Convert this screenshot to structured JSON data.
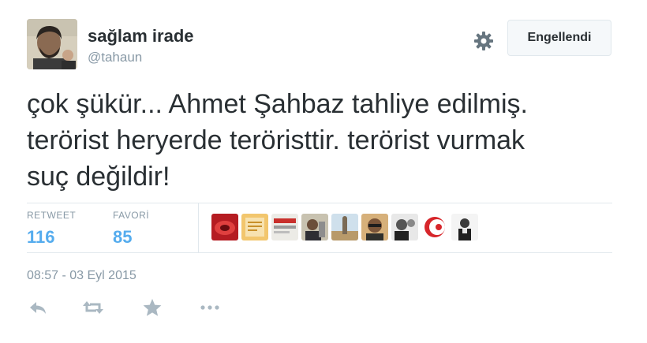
{
  "user": {
    "name": "sağlam irade",
    "handle": "@tahaun"
  },
  "follow_button": {
    "label": "Engellendi"
  },
  "tweet": {
    "lines": [
      "çok şükür... Ahmet Şahbaz tahliye edilmiş.",
      "terörist heryerde teröristtir. terörist vurmak",
      "suç değildir!"
    ]
  },
  "stats": {
    "retweet": {
      "label": "RETWEET",
      "count": "116"
    },
    "favorite": {
      "label": "FAVORİ",
      "count": "85"
    }
  },
  "timestamp": "08:57 - 03 Eyl 2015",
  "colors": {
    "accent": "#55acee",
    "muted": "#8899a6",
    "text": "#292f33",
    "icon": "#aab8c2"
  },
  "icons": [
    "gear-icon",
    "reply-icon",
    "retweet-icon",
    "favorite-icon",
    "more-icon"
  ]
}
